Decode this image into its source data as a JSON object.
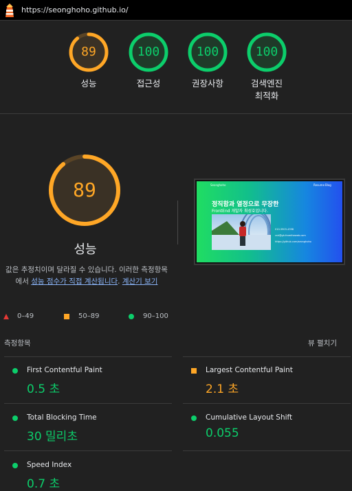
{
  "url": "https://seonghoho.github.io/",
  "colors": {
    "good": "#0cce6b",
    "average": "#ffa726",
    "fail": "#e53935",
    "link": "#8ab4f8"
  },
  "gauges": [
    {
      "score": "89",
      "label": "성능",
      "status": "average"
    },
    {
      "score": "100",
      "label": "접근성",
      "status": "good"
    },
    {
      "score": "100",
      "label": "권장사항",
      "status": "good"
    },
    {
      "score": "100",
      "label_line1": "검색엔진",
      "label_line2": "최적화",
      "status": "good"
    }
  ],
  "performance": {
    "score": "89",
    "title": "성능",
    "desc_prefix": "값은 추정치이며 달라질 수 있습니다. 이러한 측정항목에서 ",
    "desc_link1": "성능 점수가 직접 계산됩니다",
    "desc_sep": ". ",
    "desc_link2": "계산기 보기"
  },
  "screenshot": {
    "brand": "Seonghoho",
    "nav1": "Resume",
    "nav2": "Blog",
    "headline": "정직함과 열정으로 무장한",
    "subline": "FrontEnd 개발자 최성호입니다.",
    "contacts": [
      "010-5903-4398",
      "csh@gh.fromtheweb.com",
      "https://github.com/seonghoho"
    ]
  },
  "legend": [
    {
      "icon": "triangle",
      "range": "0–49"
    },
    {
      "icon": "square",
      "range": "50–89"
    },
    {
      "icon": "circle",
      "range": "90–100"
    }
  ],
  "metrics_title": "측정항목",
  "view_toggle": "뷰 펼치기",
  "metrics": [
    {
      "name": "First Contentful Paint",
      "value": "0.5 초",
      "status": "good"
    },
    {
      "name": "Largest Contentful Paint",
      "value": "2.1 초",
      "status": "average"
    },
    {
      "name": "Total Blocking Time",
      "value": "30 밀리초",
      "status": "good"
    },
    {
      "name": "Cumulative Layout Shift",
      "value": "0.055",
      "status": "good"
    },
    {
      "name": "Speed Index",
      "value": "0.7 초",
      "status": "good"
    }
  ]
}
